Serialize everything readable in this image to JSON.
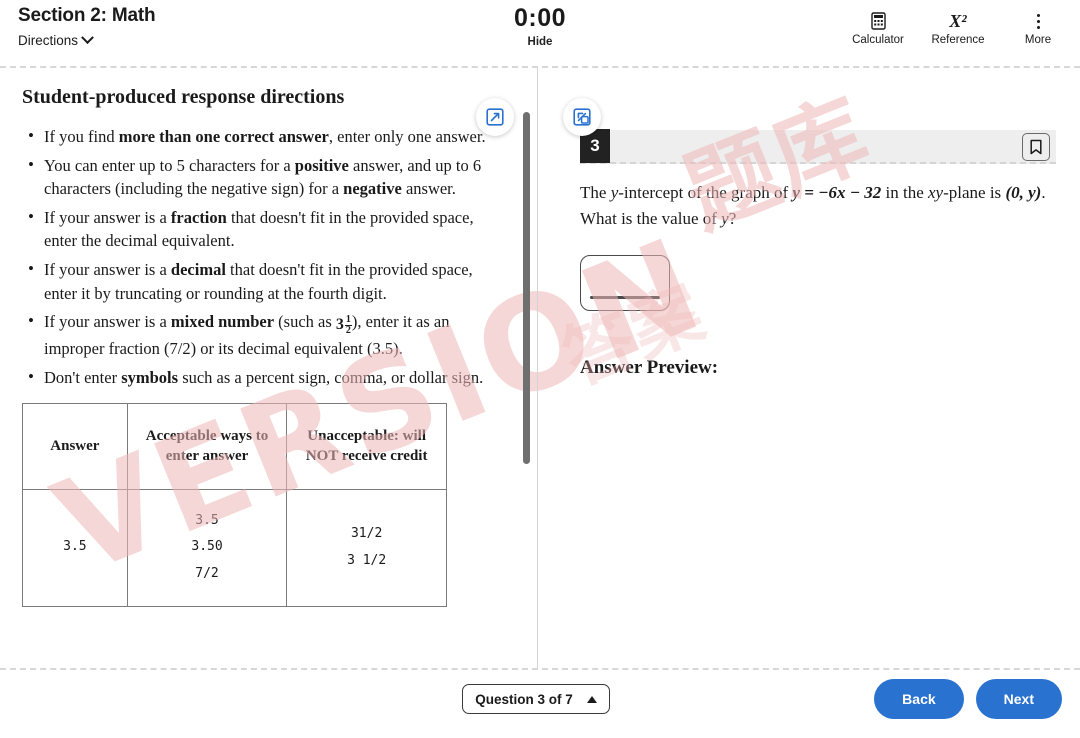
{
  "header": {
    "section_title": "Section 2: Math",
    "directions_label": "Directions",
    "timer": "0:00",
    "hide_label": "Hide",
    "tools": [
      {
        "label": "Calculator",
        "icon": "calculator-icon"
      },
      {
        "label": "Reference",
        "icon": "x-squared-icon",
        "glyph": "X²"
      },
      {
        "label": "More",
        "icon": "more-vertical-icon"
      }
    ]
  },
  "directions": {
    "title": "Student-produced response directions",
    "bullets": [
      {
        "pre": "If you find ",
        "bold": "more than one correct answer",
        "post": ", enter only one answer."
      },
      {
        "pre": "You can enter up to 5 characters for a ",
        "bold": "positive",
        "post": " answer, and up to 6 characters (including the negative sign) for a ",
        "bold2": "negative",
        "post2": " answer."
      },
      {
        "pre": "If your answer is a ",
        "bold": "fraction",
        "post": " that doesn't fit in the provided space, enter the decimal equivalent."
      },
      {
        "pre": "If your answer is a ",
        "bold": "decimal",
        "post": " that doesn't fit in the provided space, enter it by truncating or rounding at the fourth digit."
      },
      {
        "pre": "If your answer is a ",
        "bold": "mixed number",
        "post": " (such as ",
        "fraction": "3 1/2",
        "post2": "), enter it as an improper fraction (7/2) or its decimal equivalent (3.5)."
      },
      {
        "pre": "Don't enter ",
        "bold": "symbols",
        "post": " such as a percent sign, comma, or dollar sign."
      }
    ],
    "table": {
      "headers": [
        "Answer",
        "Acceptable ways to enter answer",
        "Unacceptable: will NOT receive credit"
      ],
      "rows": [
        {
          "answer": "3.5",
          "acceptable": [
            "3.5",
            "3.50",
            "7/2"
          ],
          "unacceptable": [
            "31/2",
            "3 1/2"
          ]
        }
      ]
    }
  },
  "panel_controls": {
    "expand_icon": "expand-panel-icon",
    "collapse_icon": "collapse-panel-icon"
  },
  "question": {
    "number": "3",
    "bookmark_icon": "bookmark-icon",
    "text_parts": {
      "p1": "The ",
      "var_y1": "y",
      "p2": "-intercept of the graph of ",
      "eq": "y = −6x − 32",
      "p3": " in the ",
      "var_xy": "xy",
      "p4": "-plane is ",
      "point": "(0, y)",
      "p5": ". What is the value of ",
      "var_y2": "y",
      "p6": "?"
    },
    "answer_value": "",
    "answer_placeholder": "",
    "answer_preview_label": "Answer Preview:"
  },
  "footer": {
    "question_picker": "Question 3 of 7",
    "back_label": "Back",
    "next_label": "Next"
  },
  "watermark": {
    "text1": "VERSION",
    "text2": "题库",
    "text3": "答案"
  },
  "colors": {
    "accent_blue": "#2a72d0",
    "icon_blue": "#2a72d0",
    "question_num_bg": "#222222",
    "watermark": "#f0b8b8"
  }
}
